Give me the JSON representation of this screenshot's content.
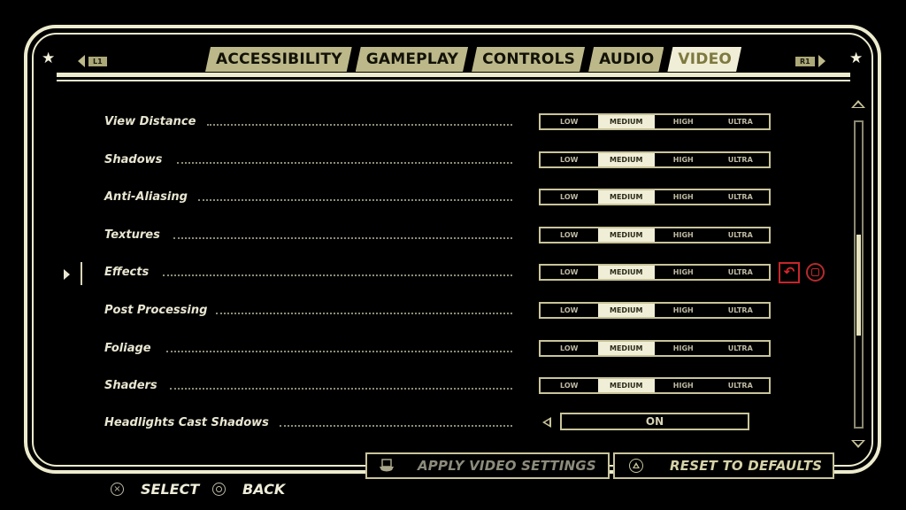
{
  "header": {
    "left_bumper": "L1",
    "right_bumper": "R1",
    "left_icon": "star-icon",
    "right_icon": "star-icon",
    "tabs": [
      {
        "label": "ACCESSIBILITY",
        "active": false
      },
      {
        "label": "GAMEPLAY",
        "active": false
      },
      {
        "label": "CONTROLS",
        "active": false
      },
      {
        "label": "AUDIO",
        "active": false
      },
      {
        "label": "VIDEO",
        "active": true
      }
    ]
  },
  "quality_options": [
    "LOW",
    "MEDIUM",
    "HIGH",
    "ULTRA"
  ],
  "settings": [
    {
      "label": "View Distance",
      "value": "MEDIUM"
    },
    {
      "label": "Shadows",
      "value": "MEDIUM"
    },
    {
      "label": "Anti-Aliasing",
      "value": "MEDIUM"
    },
    {
      "label": "Textures",
      "value": "MEDIUM"
    },
    {
      "label": "Effects",
      "value": "MEDIUM",
      "focused": true
    },
    {
      "label": "Post Processing",
      "value": "MEDIUM"
    },
    {
      "label": "Foliage",
      "value": "MEDIUM"
    },
    {
      "label": "Shaders",
      "value": "MEDIUM"
    }
  ],
  "toggle_setting": {
    "label": "Headlights Cast Shadows",
    "value": "ON"
  },
  "focused_row_actions": {
    "revert_icon": "undo-icon",
    "square_icon": "square-button-icon"
  },
  "scrollbar": {
    "position_fraction": 0.37,
    "visible_fraction": 0.33
  },
  "buttons": {
    "apply": {
      "label": "APPLY VIDEO SETTINGS",
      "icon": "touchpad-icon",
      "enabled": false
    },
    "reset": {
      "label": "RESET TO DEFAULTS",
      "icon": "triangle-button-icon"
    }
  },
  "hints": [
    {
      "icon": "cross-button-icon",
      "label": "SELECT"
    },
    {
      "icon": "circle-button-icon",
      "label": "BACK"
    }
  ],
  "colors": {
    "accent": "#ecebcd",
    "tab_bg": "#bcb889",
    "active_tab_text": "#7e7a40",
    "warning": "#c7252a"
  }
}
